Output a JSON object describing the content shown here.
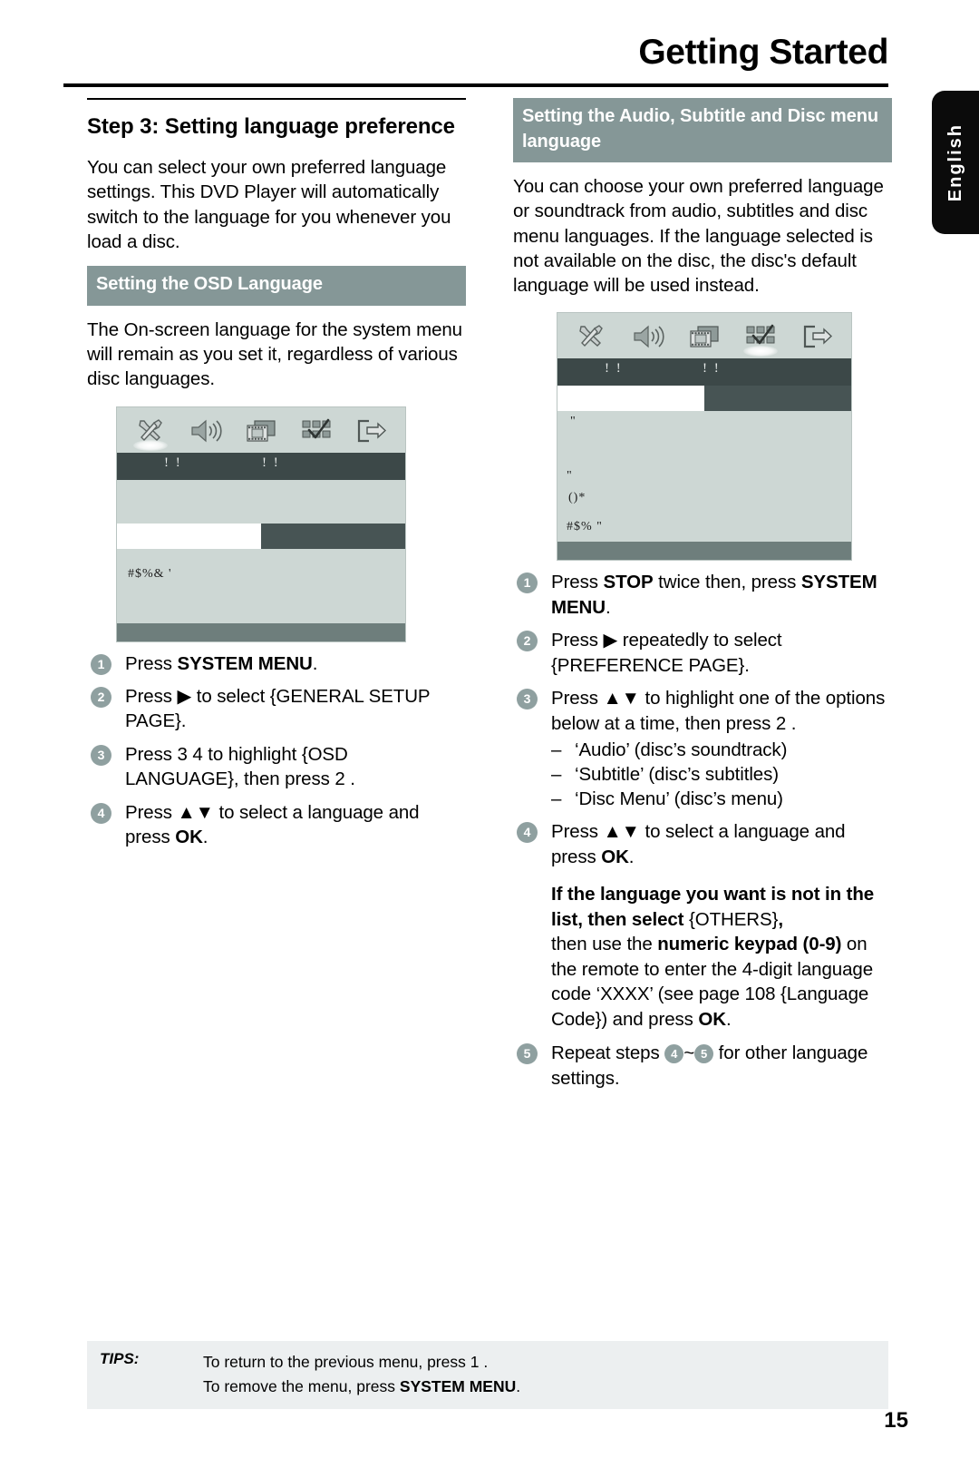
{
  "header": {
    "title": "Getting Started",
    "side_tab": "English"
  },
  "left": {
    "step_title": "Step 3:  Setting language preference",
    "intro": "You can select your own preferred language settings. This DVD Player will automatically switch to the language for you whenever you load a disc.",
    "band": "Setting the OSD Language",
    "body": "The On-screen language for the system menu will remain as you set it, regardless of various disc languages.",
    "osd": {
      "icons": [
        "tools-icon",
        "speaker-icon",
        "film-icon",
        "grid-check-icon",
        "exit-icon"
      ],
      "selected_icon_index": 0,
      "title_marks": [
        "! !",
        "! !"
      ],
      "text_lines": [
        "#$%& '"
      ]
    },
    "steps": [
      {
        "num": "1",
        "html": "Press <span class=\"b\">SYSTEM MENU</span>."
      },
      {
        "num": "2",
        "html": "Press ▶ to select {GENERAL SETUP PAGE}."
      },
      {
        "num": "3",
        "html": "Press 3 4  to highlight {OSD LANGUAGE}, then press 2 ."
      },
      {
        "num": "4",
        "html": "Press ▲▼  to select a language and press <span class=\"b\">OK</span>."
      }
    ]
  },
  "right": {
    "band": "Setting the Audio, Subtitle and Disc menu language",
    "body": "You can choose your own preferred language or soundtrack from audio, subtitles and disc menu languages. If the language selected is not available on the disc, the disc's default language will be used instead.",
    "osd": {
      "icons": [
        "tools-icon",
        "speaker-icon",
        "film-icon",
        "grid-check-icon",
        "exit-icon"
      ],
      "selected_icon_index": 3,
      "title_marks": [
        "! !",
        "! !"
      ],
      "text_lines": [
        "\"",
        "\"",
        "()*",
        "#$%  \""
      ]
    },
    "steps": [
      {
        "num": "1",
        "html": "Press <span class=\"b\">STOP</span> twice then, press <span class=\"b\">SYSTEM MENU</span>."
      },
      {
        "num": "2",
        "html": "Press ▶ repeatedly to select {PREFERENCE PAGE}."
      },
      {
        "num": "3",
        "html": "Press ▲▼  to highlight one of the options below at a time, then press 2 ."
      },
      {
        "num": "4",
        "html": "Press ▲▼  to select a language and press <span class=\"b\">OK</span>."
      },
      {
        "num": "5",
        "html": "Repeat steps <span class=\"bullet-inline\">4</span>~<span class=\"bullet-inline\">5</span> for other language settings."
      }
    ],
    "step3_options": [
      "‘Audio’ (disc’s soundtrack)",
      "‘Subtitle’ (disc’s subtitles)",
      "‘Disc Menu’ (disc’s menu)"
    ],
    "note_html": "<span class=\"b\">If the language you want is not in the list, then select</span> {OTHERS}<span class=\"b\">,</span><br>then use the <span class=\"b\">numeric keypad (0-9)</span> on the remote to enter the 4-digit language code ‘XXXX’ (see page 108 {Language Code}) and press <span class=\"b\">OK</span>."
  },
  "tips": {
    "label": "TIPS:",
    "line1_html": "To return to the previous menu, press 1 .",
    "line2_html": "To remove the menu, press <span class=\"b\">SYSTEM MENU</span>."
  },
  "page_number": "15",
  "colors": {
    "band": "#859797",
    "osd_bg": "#cdd7d4",
    "osd_titlebar": "#3c4848",
    "osd_highlight": "#475454",
    "bullet": "#8fa0a0",
    "tips_bg": "#eceff0"
  }
}
